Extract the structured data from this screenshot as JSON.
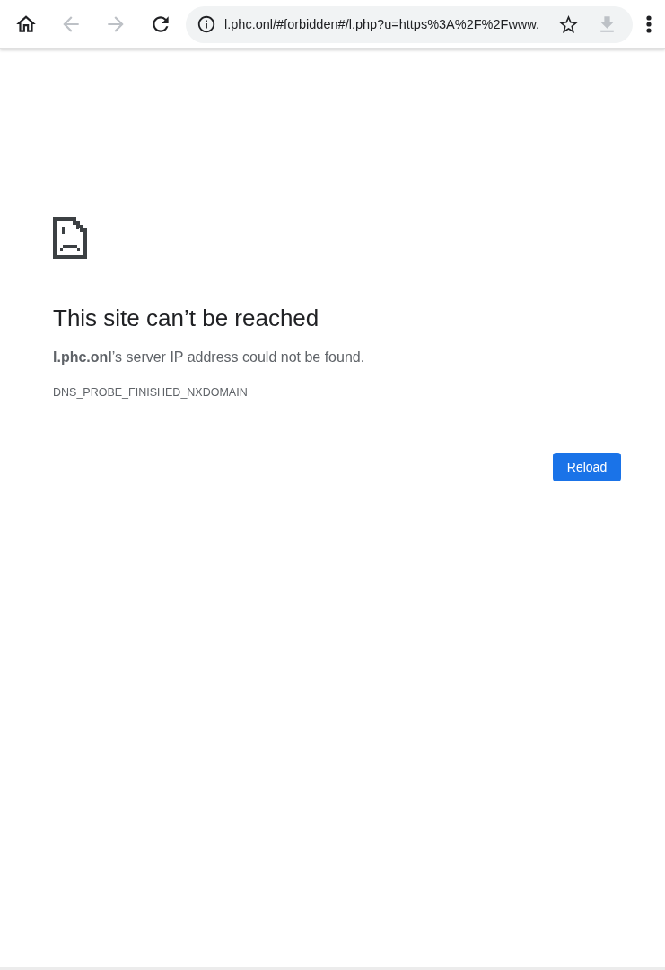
{
  "toolbar": {
    "buttons": [
      {
        "kind": "home",
        "disabled": false
      },
      {
        "kind": "back",
        "disabled": true
      },
      {
        "kind": "forward",
        "disabled": true
      },
      {
        "kind": "reload",
        "disabled": false
      }
    ],
    "address_bar": {
      "url": "l.phc.onl/#forbidden#/l.php?u=https%3A%2F%2Fwww."
    },
    "actions": [
      {
        "kind": "bookmark",
        "disabled": false
      },
      {
        "kind": "download",
        "disabled": true
      }
    ],
    "menu": {
      "kind": "menu",
      "disabled": false
    }
  },
  "error": {
    "title": "This site can’t be reached",
    "message": "**l.phc.onl**’s server IP address could not be found.",
    "code": "DNS_PROBE_FINISHED_NXDOMAIN",
    "button": "Reload"
  }
}
